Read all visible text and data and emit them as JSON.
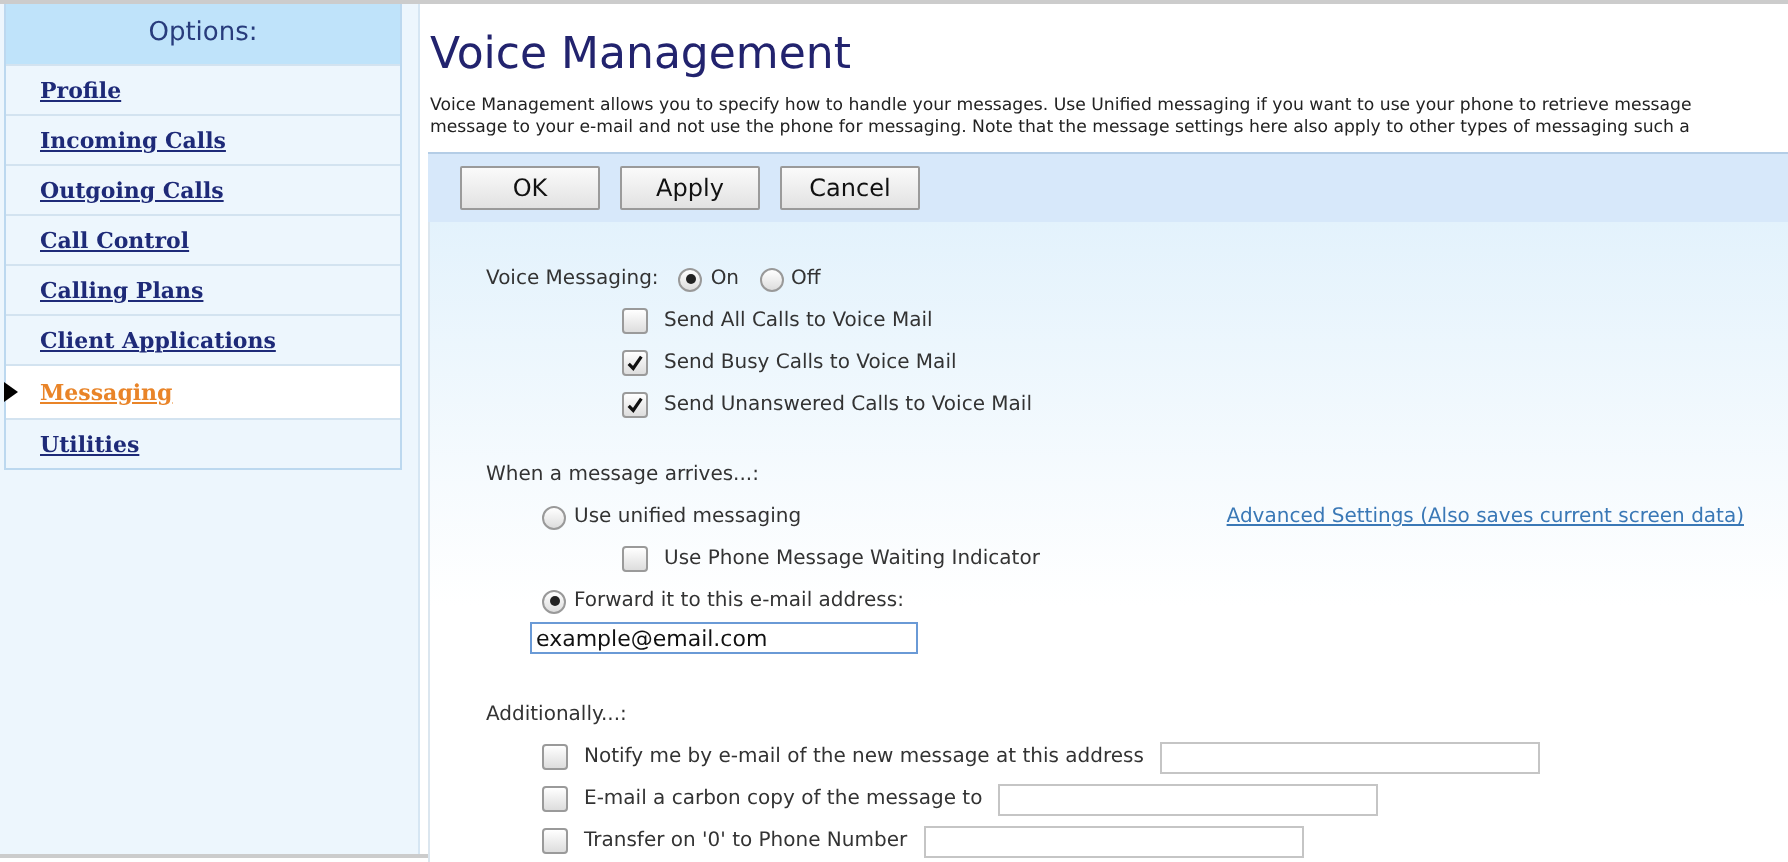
{
  "sidebar": {
    "title": "Options:",
    "items": [
      {
        "label": "Profile",
        "selected": false
      },
      {
        "label": "Incoming Calls",
        "selected": false
      },
      {
        "label": "Outgoing Calls",
        "selected": false
      },
      {
        "label": "Call Control",
        "selected": false
      },
      {
        "label": "Calling Plans",
        "selected": false
      },
      {
        "label": "Client Applications",
        "selected": false
      },
      {
        "label": "Messaging",
        "selected": true
      },
      {
        "label": "Utilities",
        "selected": false
      }
    ]
  },
  "title": "Voice Management",
  "description": [
    "Voice Management allows you to specify how to handle your messages. Use Unified messaging if you want to use your phone to retrieve message",
    "message to your e-mail and not use the phone for messaging. Note that the message settings here also apply to other types of messaging such a"
  ],
  "buttons": [
    "OK",
    "Apply",
    "Cancel"
  ],
  "voice_messaging": {
    "label": "Voice Messaging:",
    "options": [
      {
        "label": "On",
        "selected": true
      },
      {
        "label": "Off",
        "selected": false
      }
    ],
    "checkboxes": [
      {
        "label": "Send All Calls to Voice Mail",
        "checked": false
      },
      {
        "label": "Send Busy Calls to Voice Mail",
        "checked": true
      },
      {
        "label": "Send Unanswered Calls to Voice Mail",
        "checked": true
      }
    ]
  },
  "arrival": {
    "label": "When a message arrives...:",
    "unified": {
      "label": "Use unified messaging",
      "selected": false
    },
    "mwi": {
      "label": "Use Phone Message Waiting Indicator",
      "checked": false
    },
    "link": "Advanced Settings (Also saves current screen data)",
    "forward": {
      "label": "Forward it to this e-mail address:",
      "selected": true,
      "value": "example@email.com"
    }
  },
  "additionally": {
    "label": "Additionally...:",
    "items": [
      {
        "label": "Notify me by e-mail of the new message at this address",
        "checked": false
      },
      {
        "label": "E-mail a carbon copy of the message to",
        "checked": false
      },
      {
        "label": "Transfer on '0' to Phone Number",
        "checked": false
      }
    ]
  }
}
